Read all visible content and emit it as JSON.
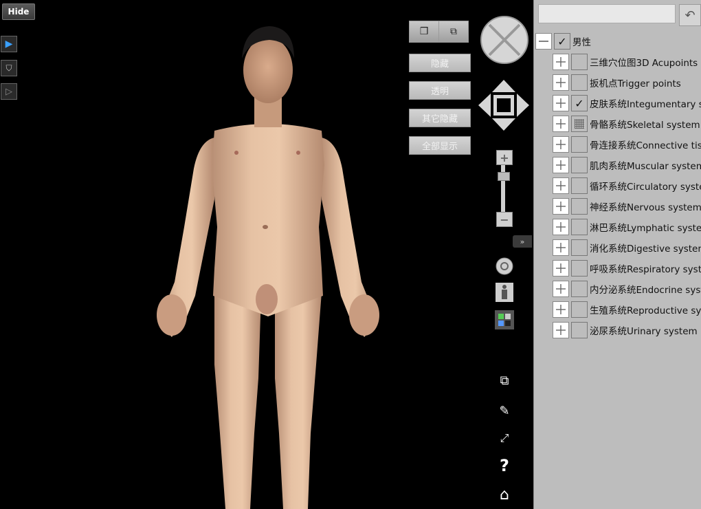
{
  "viewer": {
    "hide_label": "Hide",
    "actions": {
      "hide": "隐藏",
      "transparent": "透明",
      "hide_others": "其它隐藏",
      "show_all": "全部显示"
    },
    "collapse_label": "»",
    "help_label": "?"
  },
  "sidebar": {
    "search_placeholder": "",
    "root": {
      "label": "男性",
      "checked": true
    },
    "items": [
      {
        "label": "三维穴位图3D Acupoints",
        "state": "unchecked"
      },
      {
        "label": "扳机点Trigger points",
        "state": "unchecked"
      },
      {
        "label": "皮肤系统Integumentary sy",
        "state": "checked"
      },
      {
        "label": "骨骼系统Skeletal system",
        "state": "partial"
      },
      {
        "label": "骨连接系统Connective tiss",
        "state": "unchecked"
      },
      {
        "label": "肌肉系统Muscular system",
        "state": "unchecked"
      },
      {
        "label": "循环系统Circulatory syste",
        "state": "unchecked"
      },
      {
        "label": "神经系统Nervous system",
        "state": "unchecked"
      },
      {
        "label": "淋巴系统Lymphatic syster",
        "state": "unchecked"
      },
      {
        "label": "消化系统Digestive system",
        "state": "unchecked"
      },
      {
        "label": "呼吸系统Respiratory syste",
        "state": "unchecked"
      },
      {
        "label": "内分泌系统Endocrine syst",
        "state": "unchecked"
      },
      {
        "label": "生殖系统Reproductive sys",
        "state": "unchecked"
      },
      {
        "label": "泌尿系统Urinary system",
        "state": "unchecked"
      }
    ]
  }
}
